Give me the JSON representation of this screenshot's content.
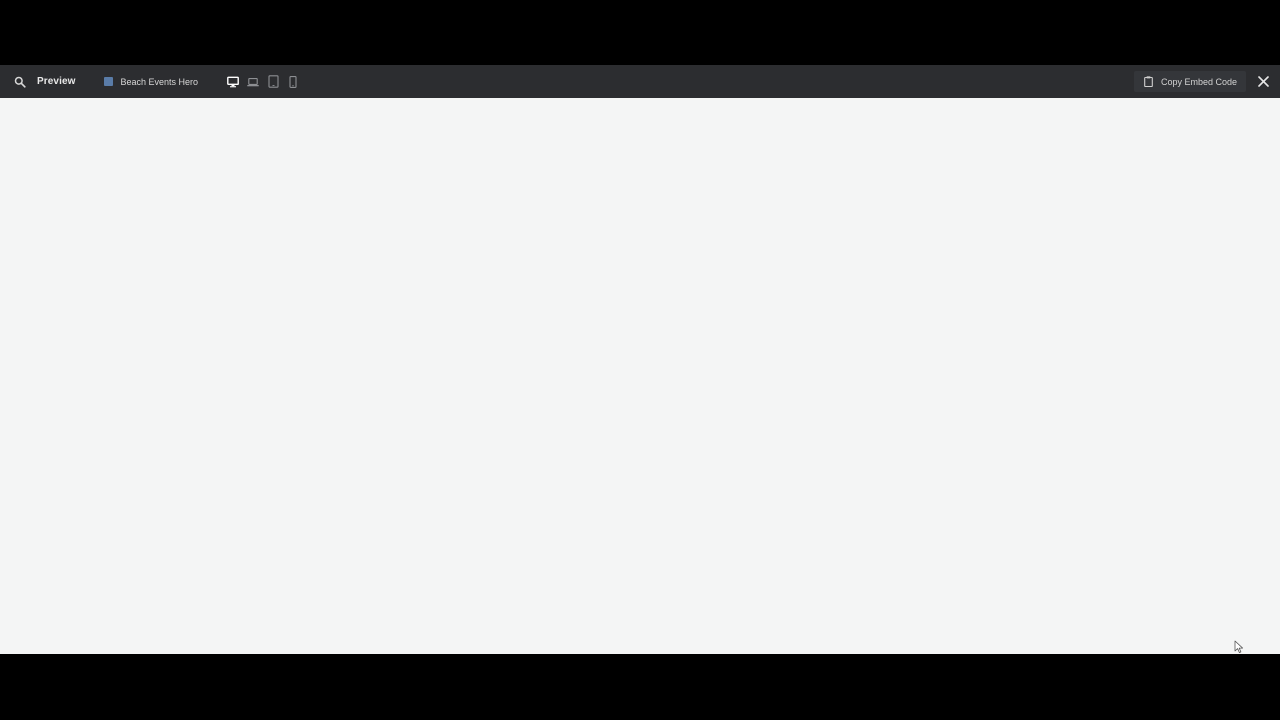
{
  "toolbar": {
    "search_icon": "search-icon",
    "mode_label": "Preview",
    "document": {
      "icon": "section-icon",
      "title": "Beach Events Hero"
    },
    "devices": [
      {
        "name": "desktop",
        "icon": "desktop-icon",
        "active": true
      },
      {
        "name": "laptop",
        "icon": "laptop-icon",
        "active": false
      },
      {
        "name": "tablet",
        "icon": "tablet-icon",
        "active": false
      },
      {
        "name": "mobile",
        "icon": "mobile-icon",
        "active": false
      }
    ],
    "copy_button_label": "Copy Embed Code",
    "copy_icon": "clipboard-icon",
    "close_icon": "close-icon"
  },
  "colors": {
    "toolbar_bg": "#2c2d30",
    "canvas_bg": "#f4f5f5",
    "letterbox": "#000000",
    "doc_icon": "#5a7ca8"
  }
}
